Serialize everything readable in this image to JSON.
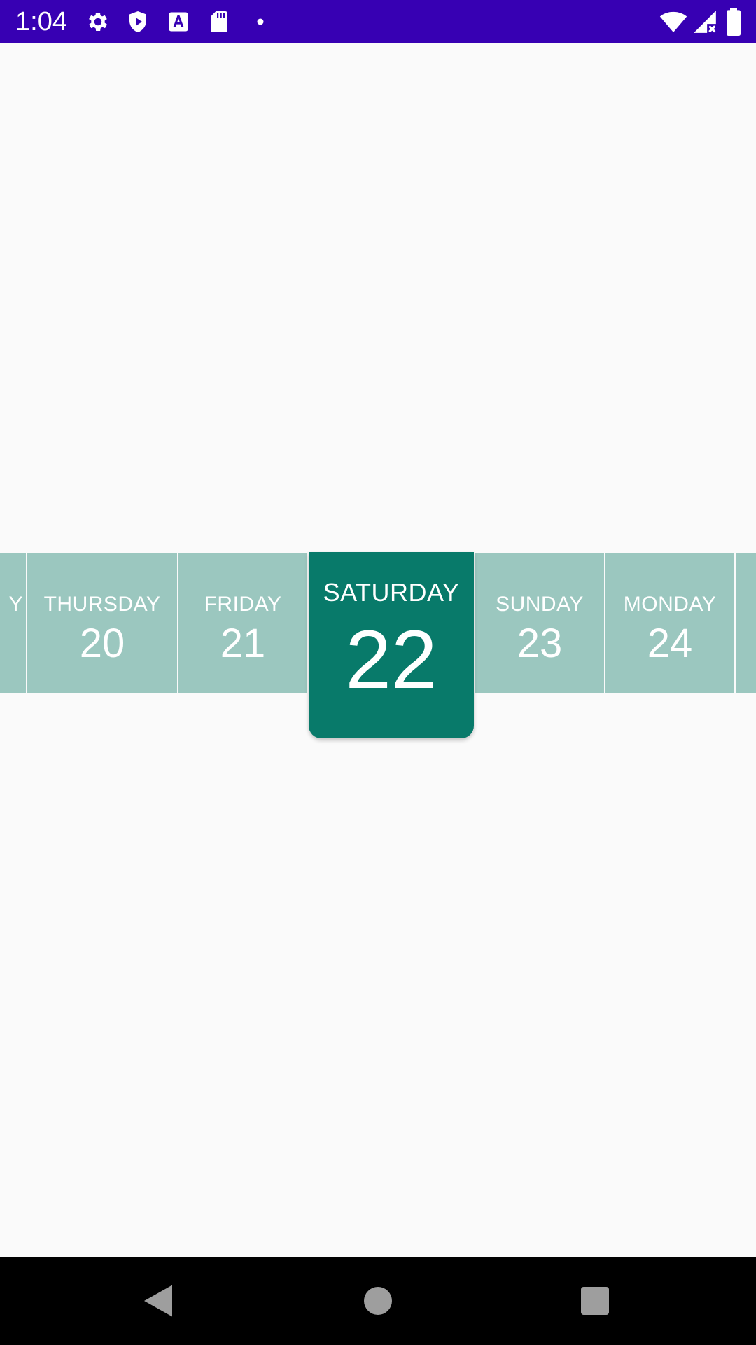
{
  "status_bar": {
    "time": "1:04",
    "background": "#3700b3",
    "left_icons": [
      "settings-gear-icon",
      "play-protect-shield-icon",
      "font-a-icon",
      "sd-card-icon",
      "notification-dot-icon"
    ],
    "right_icons": [
      "wifi-icon",
      "cell-signal-no-data-icon",
      "battery-icon"
    ]
  },
  "day_picker": {
    "unselected_color": "#9bc7bf",
    "selected_color": "#087a6a",
    "days": [
      {
        "name": "Y",
        "number": ""
      },
      {
        "name": "THURSDAY",
        "number": "20"
      },
      {
        "name": "FRIDAY",
        "number": "21"
      },
      {
        "name": "SATURDAY",
        "number": "22",
        "selected": true
      },
      {
        "name": "SUNDAY",
        "number": "23"
      },
      {
        "name": "MONDAY",
        "number": "24"
      },
      {
        "name": "",
        "number": ""
      }
    ]
  },
  "nav_bar": {
    "buttons": [
      "back-icon",
      "home-icon",
      "recents-icon"
    ]
  }
}
